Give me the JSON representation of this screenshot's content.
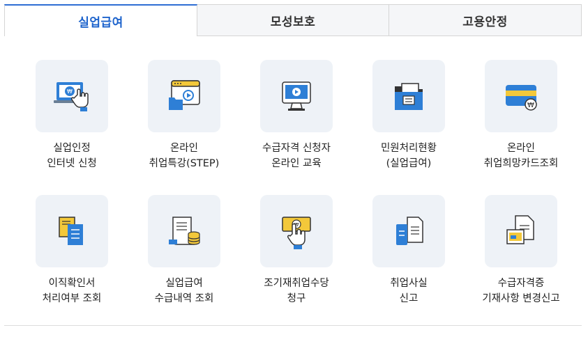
{
  "tabs": [
    {
      "label": "실업급여",
      "active": true
    },
    {
      "label": "모성보호",
      "active": false
    },
    {
      "label": "고용안정",
      "active": false
    }
  ],
  "services": [
    {
      "icon": "laptop-won-hand-icon",
      "line1": "실업인정",
      "line2": "인터넷 신청"
    },
    {
      "icon": "video-lecture-icon",
      "line1": "온라인",
      "line2": "취업특강(STEP)"
    },
    {
      "icon": "monitor-play-icon",
      "line1": "수급자격 신청자",
      "line2": "온라인 교육"
    },
    {
      "icon": "folder-document-icon",
      "line1": "민원처리현황",
      "line2": "(실업급여)"
    },
    {
      "icon": "card-won-icon",
      "line1": "온라인",
      "line2": "취업희망카드조회"
    },
    {
      "icon": "documents-stack-icon",
      "line1": "이직확인서",
      "line2": "처리여부 조회"
    },
    {
      "icon": "receipt-coins-icon",
      "line1": "실업급여",
      "line2": "수급내역 조회"
    },
    {
      "icon": "hand-banknote-icon",
      "line1": "조기재취업수당",
      "line2": "청구"
    },
    {
      "icon": "phone-document-icon",
      "line1": "취업사실",
      "line2": "신고"
    },
    {
      "icon": "document-letter-icon",
      "line1": "수급자격증",
      "line2": "기재사항 변경신고"
    }
  ],
  "colors": {
    "accent": "#1d63cc",
    "icon_blue": "#2e7fd6",
    "icon_yellow": "#f3c83a",
    "icon_bg": "#eef2f7"
  }
}
